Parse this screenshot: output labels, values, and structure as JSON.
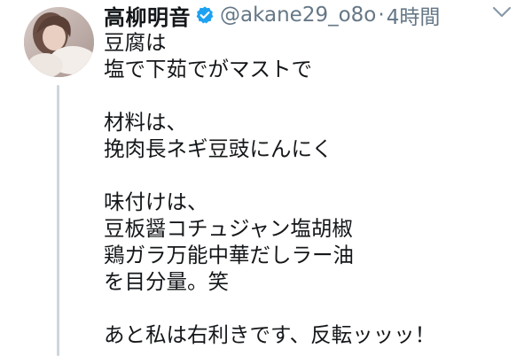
{
  "user": {
    "display_name": "高柳明音",
    "handle": "@akane29_o8o",
    "separator": "·",
    "time": "4時間"
  },
  "icons": {
    "verified": "verified-badge-icon",
    "menu": "chevron-down-icon"
  },
  "colors": {
    "verified_blue": "#1da1f2",
    "secondary_text": "#657786",
    "thread_line": "#ccd6dd"
  },
  "tweet": {
    "lines": [
      "豆腐は",
      "塩で下茹でがマストで",
      "",
      "材料は、",
      "挽肉長ネギ豆豉にんにく",
      "",
      "味付けは、",
      "豆板醤コチュジャン塩胡椒",
      "鶏ガラ万能中華だしラー油",
      "を目分量。笑",
      "",
      "あと私は右利きです、反転ッッッ！"
    ]
  }
}
